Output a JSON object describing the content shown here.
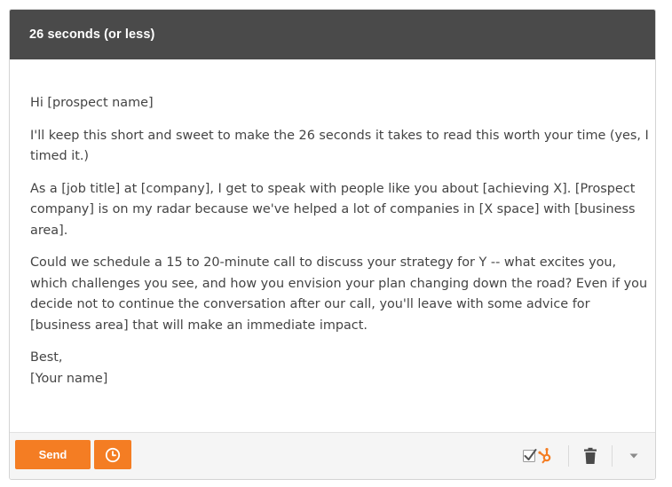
{
  "header": {
    "title": "26 seconds (or less)"
  },
  "email": {
    "greeting": "Hi [prospect name]",
    "paragraphs": [
      "I'll keep this short and sweet to make the 26 seconds it takes to read this worth your time (yes, I timed it.)",
      "As a [job title] at [company], I get to speak with people like you about [achieving X]. [Prospect company] is on my radar because we've helped a lot of companies in [X space] with [business area].",
      "Could we schedule a 15 to 20-minute call to discuss your strategy for Y -- what excites you, which challenges you see, and how you envision your plan changing down the road? Even if you decide not to continue the conversation after our call, you'll leave with some advice for [business area] that will make an immediate impact."
    ],
    "closing": "Best,",
    "signature": "[Your name]"
  },
  "footer": {
    "send_label": "Send",
    "schedule_icon": "clock-icon",
    "track_icon": "hubspot-track-icon",
    "delete_icon": "trash-icon",
    "more_icon": "caret-down-icon"
  },
  "colors": {
    "header_bg": "#4a4a4a",
    "accent": "#f47d23",
    "text": "#444444",
    "footer_bg": "#f5f5f5"
  }
}
